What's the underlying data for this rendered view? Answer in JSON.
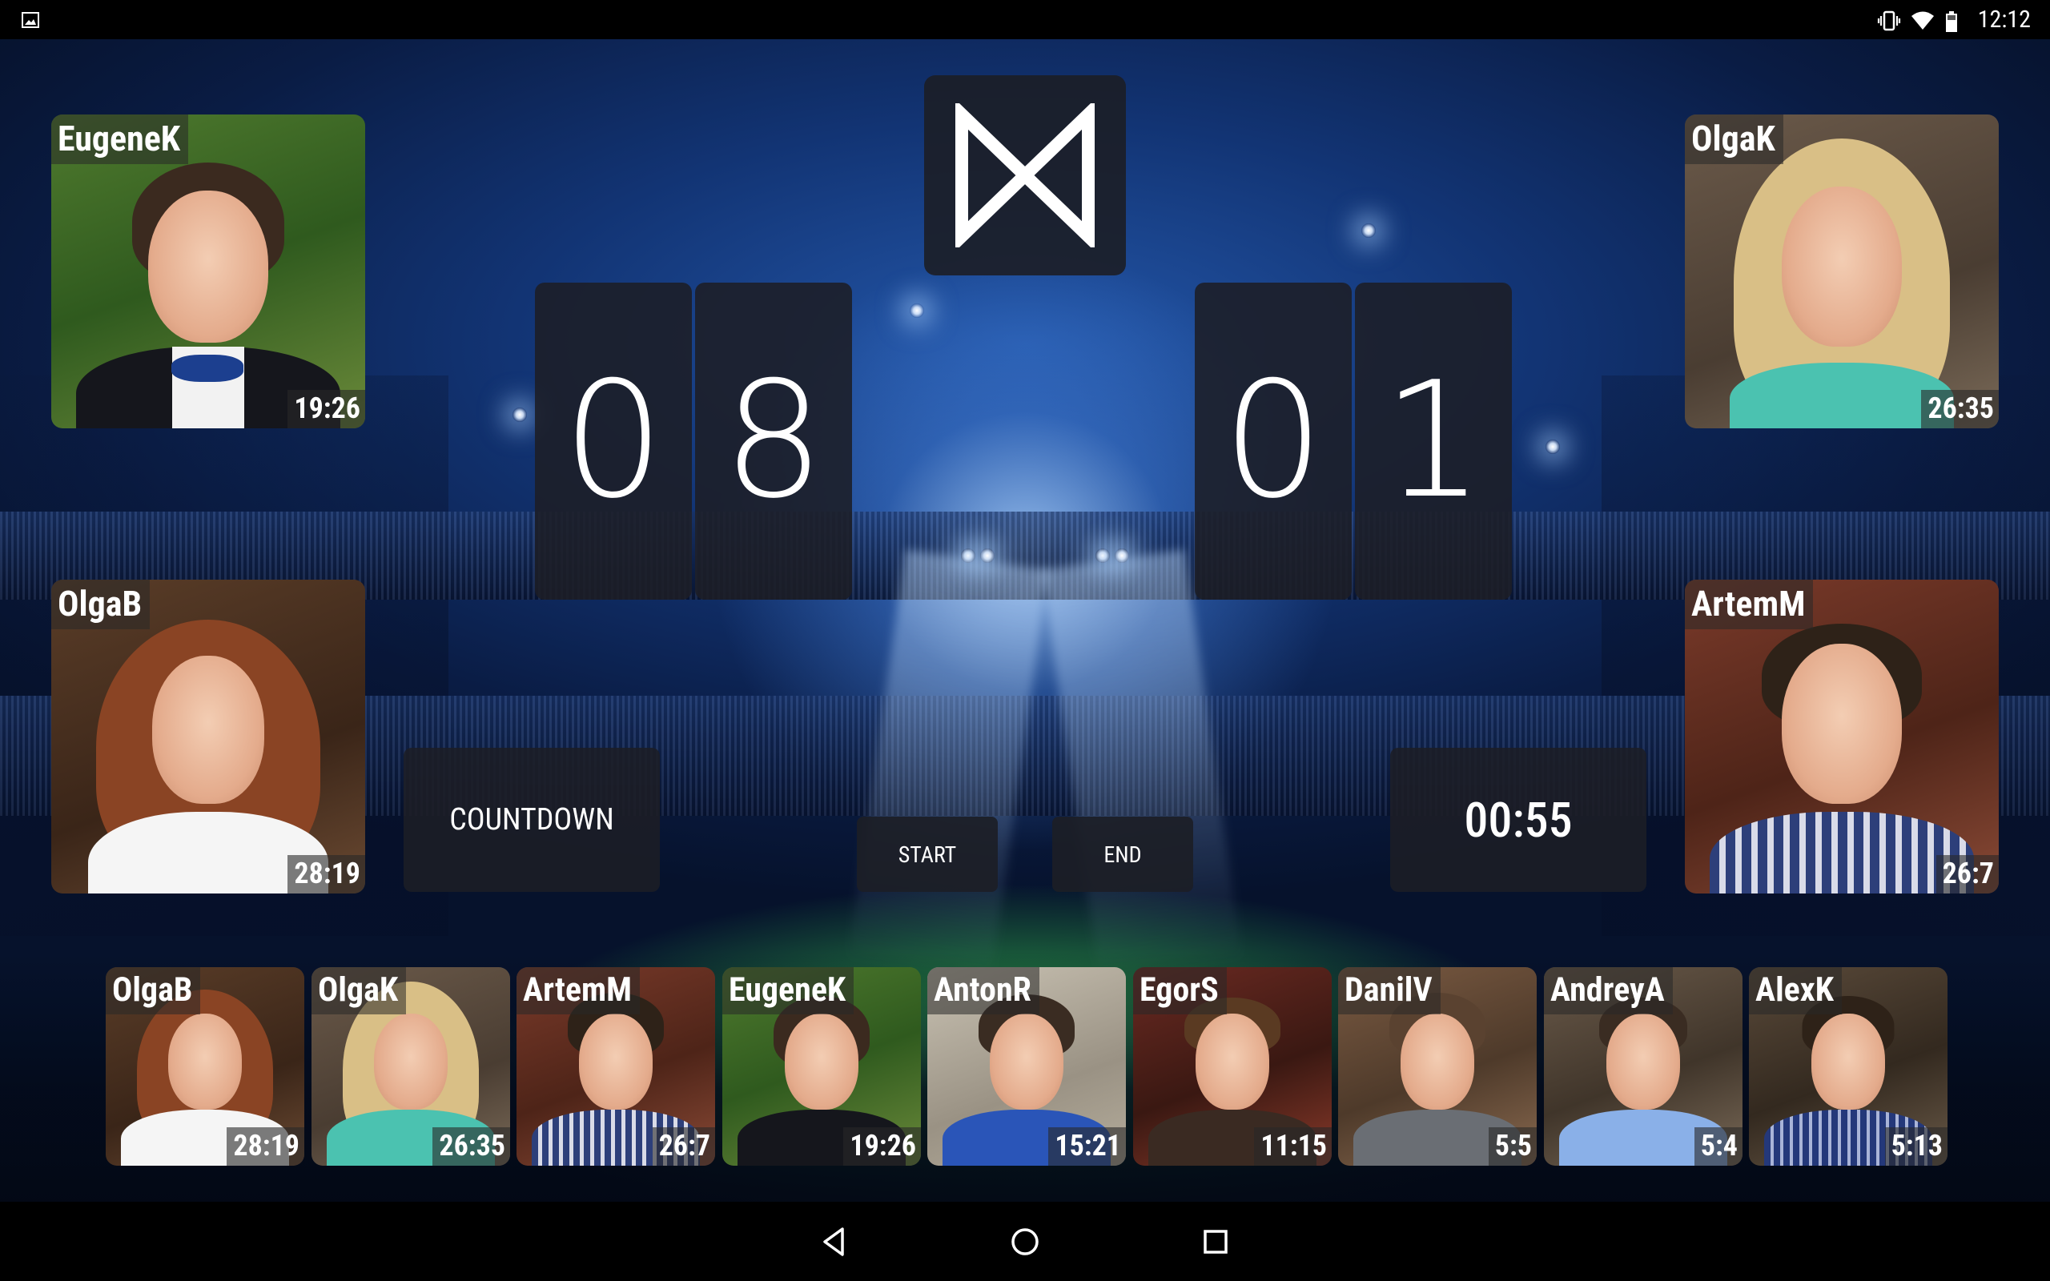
{
  "status_bar": {
    "time": "12:12",
    "icons": [
      "image-icon",
      "vibrate-icon",
      "wifi-icon",
      "battery-icon"
    ]
  },
  "score": {
    "left_digits": [
      "0",
      "8"
    ],
    "right_digits": [
      "0",
      "1"
    ]
  },
  "logo": {
    "icon": "bowtie-logo-icon"
  },
  "countdown": {
    "label": "COUNTDOWN",
    "timer": "00:55"
  },
  "controls": {
    "start_label": "START",
    "end_label": "END"
  },
  "featured_players": {
    "top_left": {
      "name": "EugeneK",
      "time": "19:26"
    },
    "mid_left": {
      "name": "OlgaB",
      "time": "28:19"
    },
    "top_right": {
      "name": "OlgaK",
      "time": "26:35"
    },
    "mid_right": {
      "name": "ArtemM",
      "time": "26:7"
    }
  },
  "roster": [
    {
      "name": "OlgaB",
      "time": "28:19"
    },
    {
      "name": "OlgaK",
      "time": "26:35"
    },
    {
      "name": "ArtemM",
      "time": "26:7"
    },
    {
      "name": "EugeneK",
      "time": "19:26"
    },
    {
      "name": "AntonR",
      "time": "15:21"
    },
    {
      "name": "EgorS",
      "time": "11:15"
    },
    {
      "name": "DanilV",
      "time": "5:5"
    },
    {
      "name": "AndreyA",
      "time": "5:4"
    },
    {
      "name": "AlexK",
      "time": "5:13"
    }
  ],
  "nav": {
    "back": "back-icon",
    "home": "home-icon",
    "recents": "recents-icon"
  }
}
